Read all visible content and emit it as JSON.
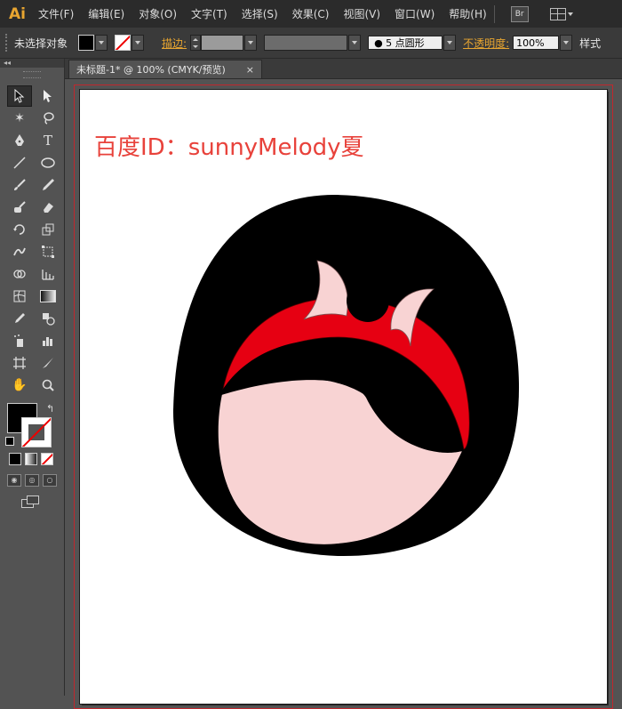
{
  "app": {
    "logo": "Ai"
  },
  "menu": {
    "items": [
      "文件(F)",
      "编辑(E)",
      "对象(O)",
      "文字(T)",
      "选择(S)",
      "效果(C)",
      "视图(V)",
      "窗口(W)",
      "帮助(H)"
    ],
    "bridge_label": "Br"
  },
  "control": {
    "selection_status": "未选择对象",
    "stroke_label": "描边:",
    "brush": "● 5 点圆形",
    "opacity_label": "不透明度:",
    "opacity_value": "100%",
    "style_label": "样式"
  },
  "toolbox": {
    "collapse_label": "◂◂"
  },
  "document": {
    "tab_title": "未标题-1* @ 100% (CMYK/预览)",
    "close_glyph": "×"
  },
  "artwork": {
    "watermark": "百度ID：sunnyMelody夏",
    "colors": {
      "hair": "#000000",
      "face": "#f8d3d3",
      "headband": "#e60012",
      "bow": "#f8d3d3",
      "watermark": "#e8423b"
    }
  }
}
